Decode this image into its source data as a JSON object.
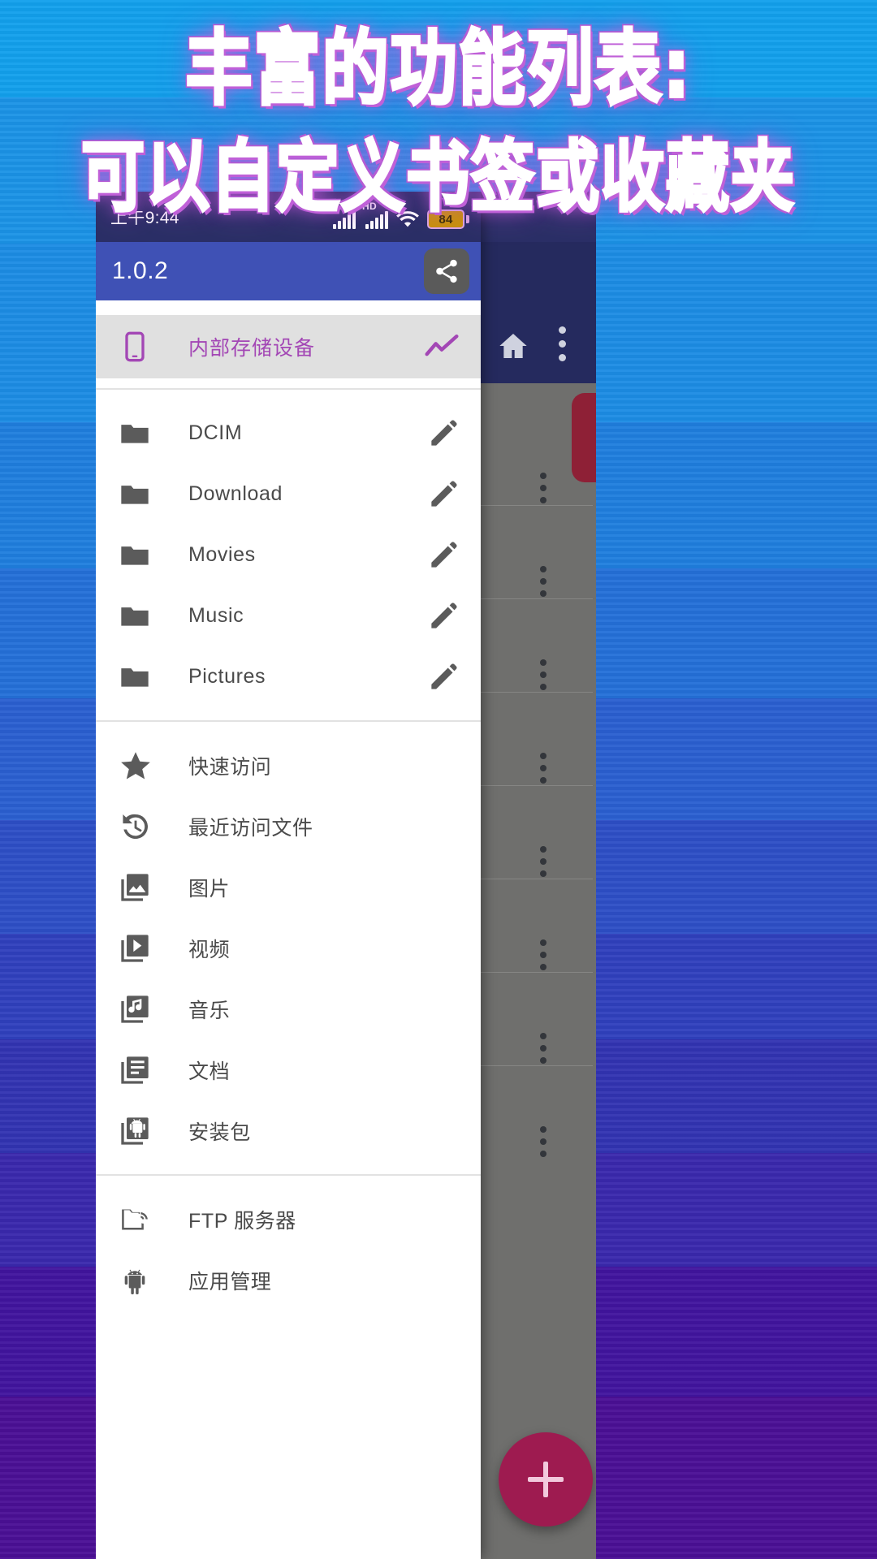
{
  "poster": {
    "headline_line1": "丰富的功能列表:",
    "headline_line2": "可以自定义书签或收藏夹",
    "accent_color": "#c060d8",
    "background_top_color": "#12a0ec",
    "background_bottom_color": "#4a0f95"
  },
  "statusbar": {
    "time": "上午9:44",
    "signal1_label": "HD",
    "signal2_label": "HD",
    "wifi_icon": "wifi-icon",
    "battery_level": "84"
  },
  "appbar": {
    "title": "1.0.2",
    "share_icon": "share-icon"
  },
  "storage": {
    "icon": "phone-icon",
    "label": "内部存储设备",
    "action_icon": "analytics-chart-icon",
    "color": "#a347b5"
  },
  "folders": [
    {
      "icon": "folder-icon",
      "label": "DCIM",
      "action_icon": "edit-pencil-icon"
    },
    {
      "icon": "folder-icon",
      "label": "Download",
      "action_icon": "edit-pencil-icon"
    },
    {
      "icon": "folder-icon",
      "label": "Movies",
      "action_icon": "edit-pencil-icon"
    },
    {
      "icon": "folder-icon",
      "label": "Music",
      "action_icon": "edit-pencil-icon"
    },
    {
      "icon": "folder-icon",
      "label": "Pictures",
      "action_icon": "edit-pencil-icon"
    }
  ],
  "categories": [
    {
      "icon": "star-icon",
      "label": "快速访问"
    },
    {
      "icon": "history-icon",
      "label": "最近访问文件"
    },
    {
      "icon": "image-collection-icon",
      "label": "图片"
    },
    {
      "icon": "video-collection-icon",
      "label": "视频"
    },
    {
      "icon": "music-collection-icon",
      "label": "音乐"
    },
    {
      "icon": "document-collection-icon",
      "label": "文档"
    },
    {
      "icon": "android-package-icon",
      "label": "安装包"
    }
  ],
  "tools": [
    {
      "icon": "ftp-folder-icon",
      "label": "FTP 服务器"
    },
    {
      "icon": "android-robot-icon",
      "label": "应用管理"
    }
  ],
  "background_app": {
    "home_icon": "home-icon",
    "overflow_icon": "more-vertical-icon",
    "fab_icon": "plus-icon",
    "fab_color": "#9e1b50"
  }
}
